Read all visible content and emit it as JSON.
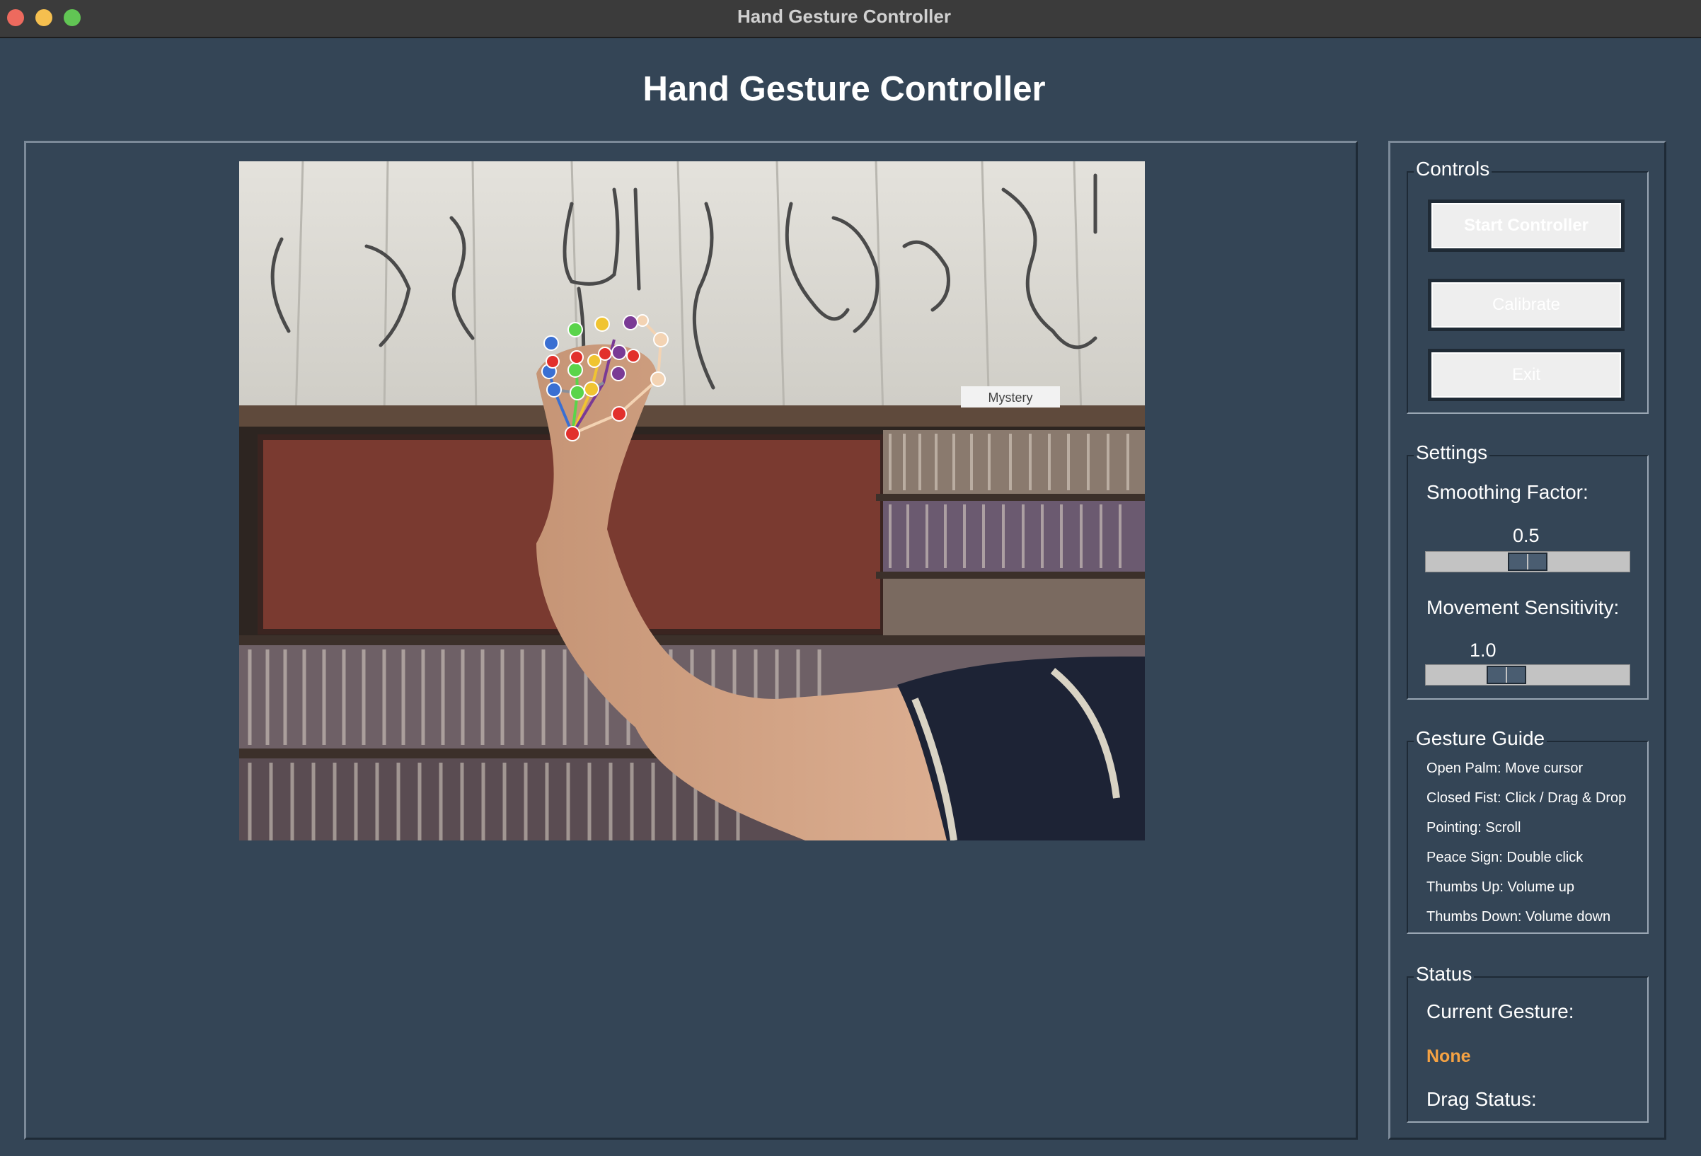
{
  "window": {
    "title": "Hand Gesture Controller",
    "buttons": [
      "close",
      "minimize",
      "maximize"
    ]
  },
  "app": {
    "title": "Hand Gesture Controller"
  },
  "camera": {
    "overlay_text": "Mystery"
  },
  "controls": {
    "legend": "Controls",
    "start_label": "Start Controller",
    "calibrate_label": "Calibrate",
    "exit_label": "Exit"
  },
  "settings": {
    "legend": "Settings",
    "smoothing": {
      "label": "Smoothing Factor:",
      "value": "0.5",
      "fraction": 0.5
    },
    "sensitivity": {
      "label": "Movement Sensitivity:",
      "value": "1.0",
      "fraction": 0.37
    }
  },
  "guide": {
    "legend": "Gesture Guide",
    "items": [
      "Open Palm: Move cursor",
      "Closed Fist: Click / Drag & Drop",
      "Pointing: Scroll",
      "Peace Sign: Double click",
      "Thumbs Up: Volume up",
      "Thumbs Down: Volume down"
    ]
  },
  "status": {
    "legend": "Status",
    "gesture_label": "Current Gesture:",
    "gesture_value": "None",
    "drag_label": "Drag Status:",
    "accent_color": "#f5a243"
  },
  "colors": {
    "background": "#344556",
    "titlebar": "#3b3b3b"
  }
}
